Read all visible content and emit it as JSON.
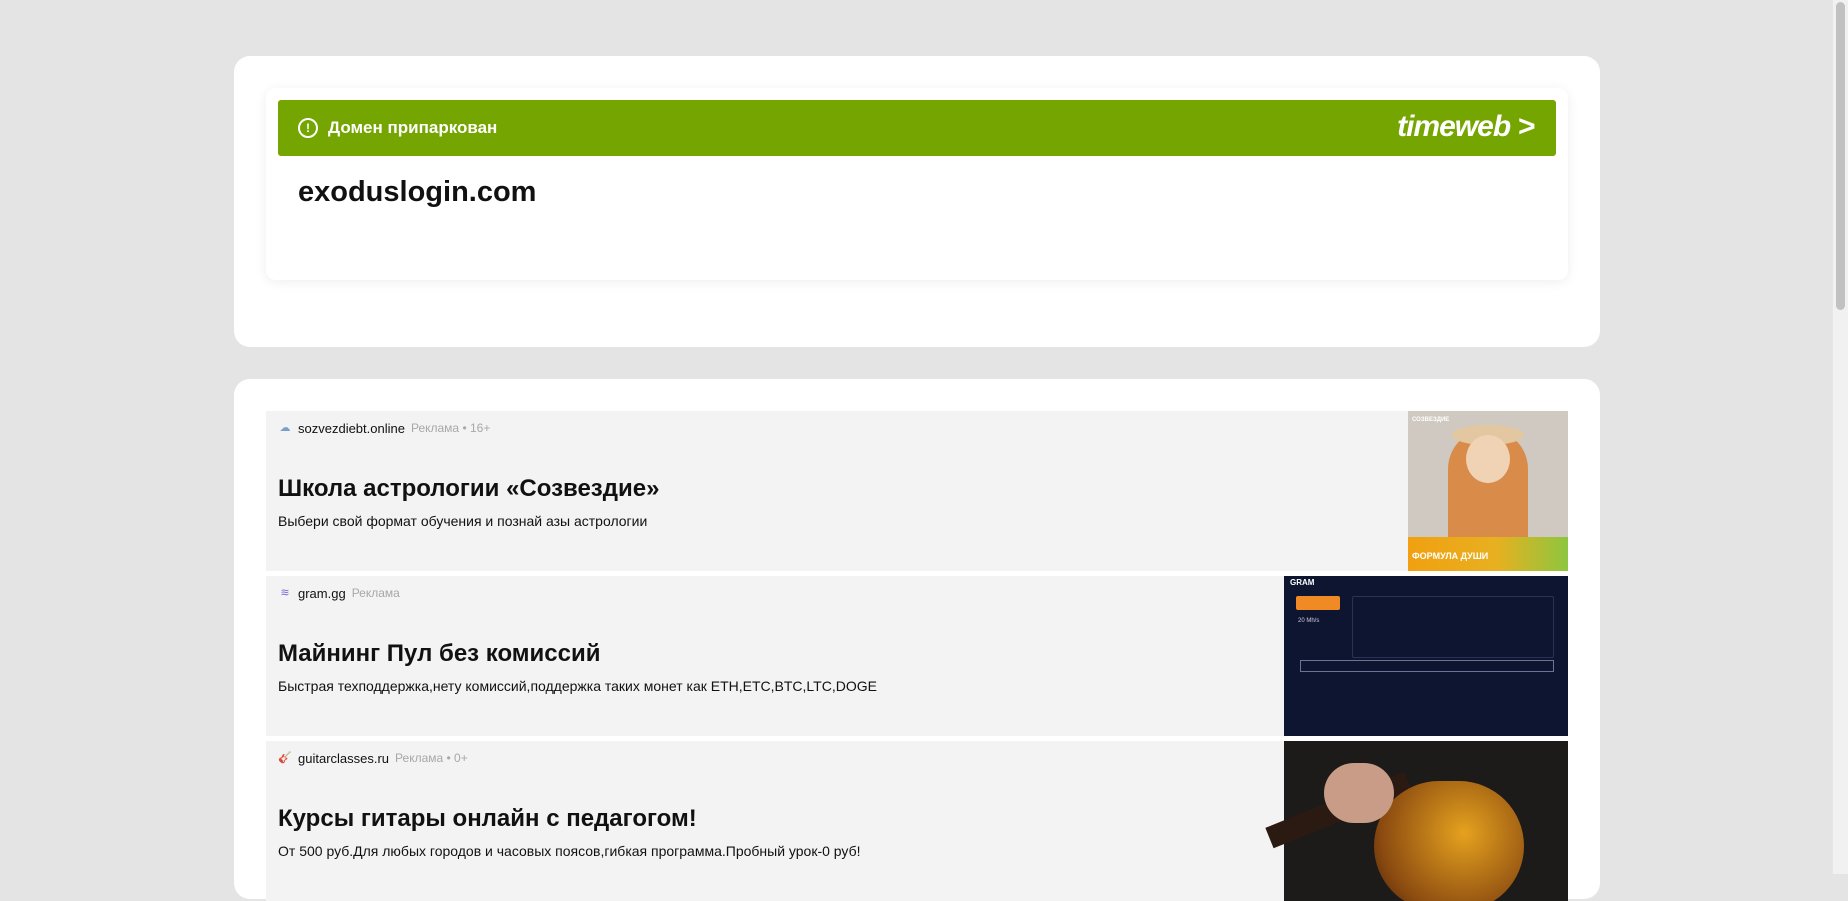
{
  "parked": {
    "banner_label": "Домен припаркован",
    "provider_logo": "timeweb >",
    "domain": "exoduslogin.com",
    "banner_color": "#74a500"
  },
  "ads": [
    {
      "domain": "sozvezdiebt.online",
      "sponsored": "Реклама • 16+",
      "title": "Школа астрологии «Созвездие»",
      "description": "Выбери свой формат обучения и познай азы астрологии",
      "image_caption": "ФОРМУЛА ДУШИ"
    },
    {
      "domain": "gram.gg",
      "sponsored": "Реклама",
      "title": "Майнинг Пул без комиссий",
      "description": "Быстрая техподдержка,нету комиссий,поддержка таких монет как ETH,ETC,BTC,LTC,DOGE",
      "image_caption": "GRAM"
    },
    {
      "domain": "guitarclasses.ru",
      "sponsored": "Реклама • 0+",
      "title": "Курсы гитары онлайн с педагогом!",
      "description": "От 500 руб.Для любых городов и часовых поясов,гибкая программа.Пробный урок-0 руб!"
    }
  ],
  "icons": {
    "alert": "exclamation-circle-icon",
    "ad_menu": "more-vertical-icon"
  }
}
